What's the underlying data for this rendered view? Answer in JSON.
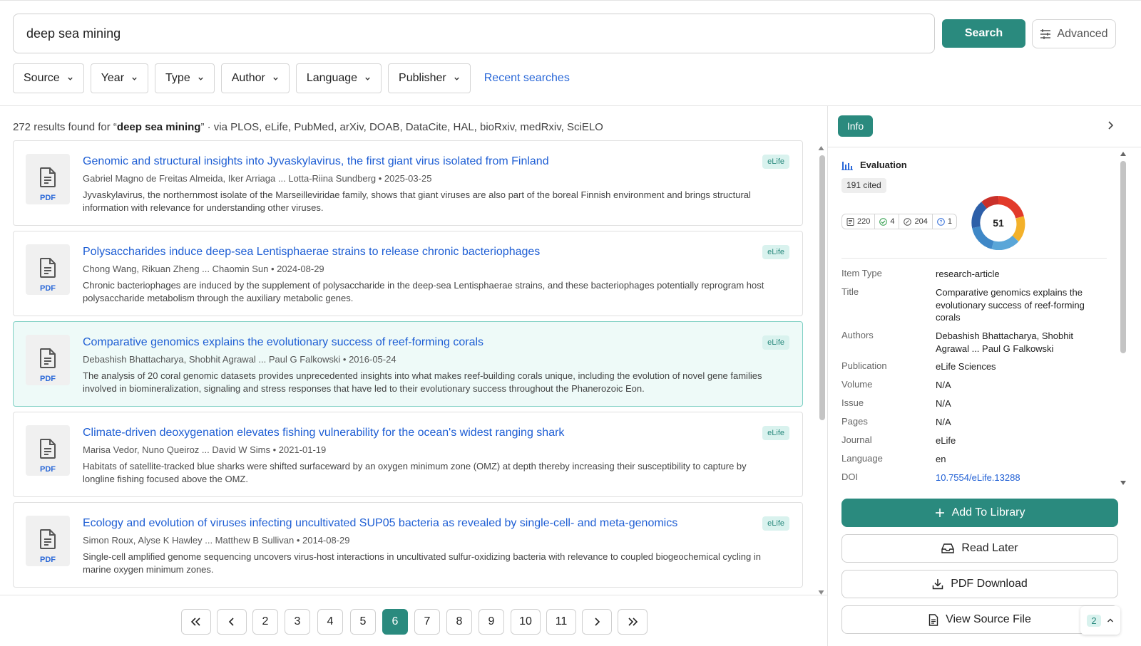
{
  "search": {
    "query": "deep sea mining",
    "button_label": "Search",
    "advanced_label": "Advanced"
  },
  "filters": [
    "Source",
    "Year",
    "Type",
    "Author",
    "Language",
    "Publisher"
  ],
  "recent_searches_label": "Recent searches",
  "summary": {
    "prefix": "272 results found for “",
    "query": "deep sea mining",
    "suffix": "” · via PLOS, eLife, PubMed, arXiv, DOAB, DataCite, HAL, bioRxiv, medRxiv, SciELO"
  },
  "results": [
    {
      "title": "Genomic and structural insights into Jyvaskylavirus, the first giant virus isolated from Finland",
      "meta": "Gabriel Magno de Freitas Almeida, Iker Arriaga ... Lotta-Riina Sundberg • 2025-03-25",
      "abstract": "Jyvaskylavirus, the northernmost isolate of the Marseilleviridae family, shows that giant viruses are also part of the boreal Finnish environment and brings structural information with relevance for understanding other viruses.",
      "source": "eLife",
      "file_label": "PDF",
      "active": false
    },
    {
      "title": "Polysaccharides induce deep-sea Lentisphaerae strains to release chronic bacteriophages",
      "meta": "Chong Wang, Rikuan Zheng ... Chaomin Sun • 2024-08-29",
      "abstract": "Chronic bacteriophages are induced by the supplement of polysaccharide in the deep-sea Lentisphaerae strains, and these bacteriophages potentially reprogram host polysaccharide metabolism through the auxiliary metabolic genes.",
      "source": "eLife",
      "file_label": "PDF",
      "active": false
    },
    {
      "title": "Comparative genomics explains the evolutionary success of reef-forming corals",
      "meta": "Debashish Bhattacharya, Shobhit Agrawal ... Paul G Falkowski • 2016-05-24",
      "abstract": "The analysis of 20 coral genomic datasets provides unprecedented insights into what makes reef-building corals unique, including the evolution of novel gene families involved in biomineralization, signaling and stress responses that have led to their evolutionary success throughout the Phanerozoic Eon.",
      "source": "eLife",
      "file_label": "PDF",
      "active": true
    },
    {
      "title": "Climate-driven deoxygenation elevates fishing vulnerability for the ocean's widest ranging shark",
      "meta": "Marisa Vedor, Nuno Queiroz ... David W Sims • 2021-01-19",
      "abstract": "Habitats of satellite-tracked blue sharks were shifted surfaceward by an oxygen minimum zone (OMZ) at depth thereby increasing their susceptibility to capture by longline fishing focused above the OMZ.",
      "source": "eLife",
      "file_label": "PDF",
      "active": false
    },
    {
      "title": "Ecology and evolution of viruses infecting uncultivated SUP05 bacteria as revealed by single-cell- and meta-genomics",
      "meta": "Simon Roux, Alyse K Hawley ... Matthew B Sullivan • 2014-08-29",
      "abstract": "Single-cell amplified genome sequencing uncovers virus-host interactions in uncultivated sulfur-oxidizing bacteria with relevance to coupled biogeochemical cycling in marine oxygen minimum zones.",
      "source": "eLife",
      "file_label": "PDF",
      "active": false
    }
  ],
  "pagination": {
    "pages": [
      "2",
      "3",
      "4",
      "5",
      "6",
      "7",
      "8",
      "9",
      "10",
      "11"
    ],
    "current": "6"
  },
  "panel": {
    "tab_label": "Info",
    "evaluation_title": "Evaluation",
    "cited": "191 cited",
    "metrics": [
      "220",
      "4",
      "204",
      "1"
    ],
    "score": "51",
    "details": [
      {
        "label": "Item Type",
        "value": "research-article"
      },
      {
        "label": "Title",
        "value": "Comparative genomics explains the evolutionary success of reef-forming corals"
      },
      {
        "label": "Authors",
        "value": "Debashish Bhattacharya, Shobhit Agrawal ... Paul G Falkowski"
      },
      {
        "label": "Publication",
        "value": "eLife Sciences"
      },
      {
        "label": "Volume",
        "value": "N/A"
      },
      {
        "label": "Issue",
        "value": "N/A"
      },
      {
        "label": "Pages",
        "value": "N/A"
      },
      {
        "label": "Journal",
        "value": "eLife"
      },
      {
        "label": "Language",
        "value": "en"
      },
      {
        "label": "DOI",
        "value": "10.7554/eLife.13288"
      }
    ],
    "actions": {
      "add": "Add To Library",
      "read_later": "Read Later",
      "pdf": "PDF Download",
      "source": "View Source File"
    },
    "mini_count": "2"
  },
  "colors": {
    "accent": "#2a8a7e",
    "link": "#1e5ed4",
    "badge_bg": "#d9f2ee"
  }
}
